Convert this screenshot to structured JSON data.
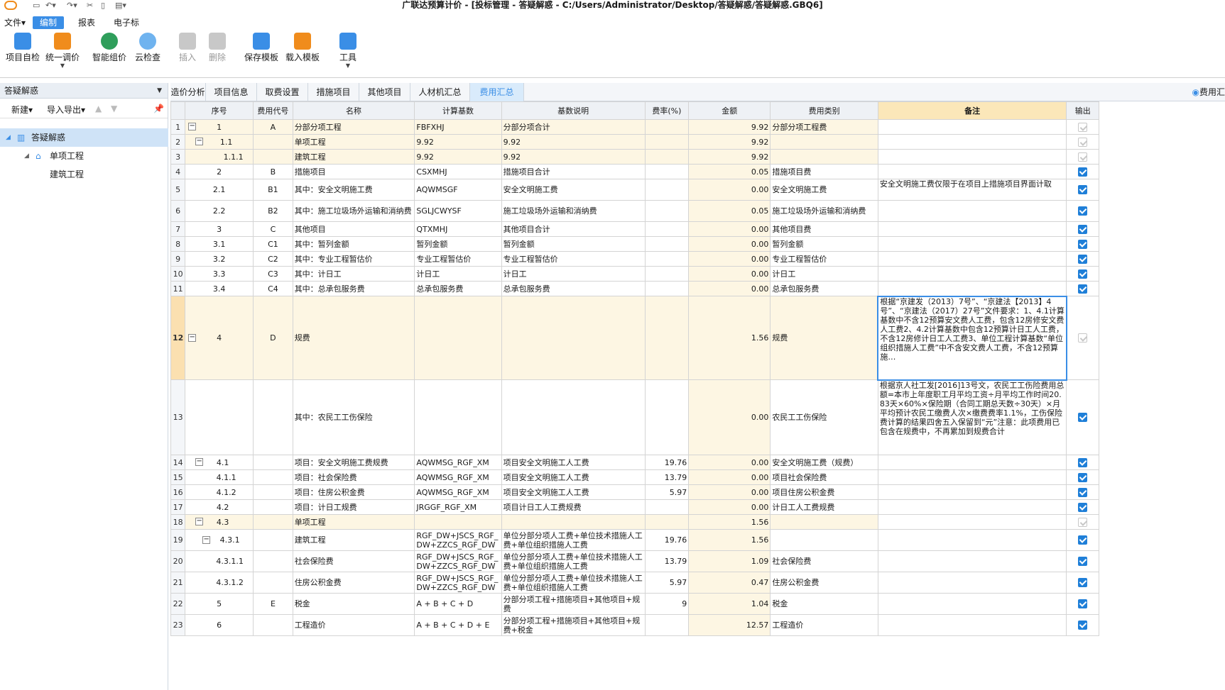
{
  "window": {
    "title": "广联达预算计价 - [投标管理 - 答疑解惑 - C:/Users/Administrator/Desktop/答疑解惑/答疑解惑.GBQ6]"
  },
  "menu": {
    "file": "文件▾",
    "edit": "编制",
    "report": "报表",
    "etender": "电子标"
  },
  "ribbon": {
    "self_check": "项目自检",
    "unify_price": "统一调价",
    "smart_price": "智能组价",
    "cloud_check": "云检查",
    "insert": "插入",
    "delete": "删除",
    "save_tpl": "保存模板",
    "load_tpl": "载入模板",
    "tools": "工具"
  },
  "left": {
    "header": "答疑解惑",
    "new": "新建▾",
    "import_export": "导入导出▾",
    "tree": {
      "root": "答疑解惑",
      "unit": "单项工程",
      "sub": "建筑工程"
    }
  },
  "tabs": [
    "造价分析",
    "项目信息",
    "取费设置",
    "措施项目",
    "其他项目",
    "人材机汇总",
    "费用汇总"
  ],
  "right_label": "费用汇",
  "columns": [
    "序号",
    "费用代号",
    "名称",
    "计算基数",
    "基数说明",
    "费率(%)",
    "金额",
    "费用类别",
    "备注",
    "输出"
  ],
  "rows": [
    {
      "n": "1",
      "seq": "1",
      "code": "A",
      "name": "分部分项工程",
      "base": "FBFXHJ",
      "desc": "分部分项合计",
      "rate": "",
      "amt": "9.92",
      "cat": "分部分项工程费",
      "note": ""
    },
    {
      "n": "2",
      "seq": "1.1",
      "code": "",
      "name": "单项工程",
      "base": "9.92",
      "desc": "9.92",
      "rate": "",
      "amt": "9.92",
      "cat": "",
      "note": ""
    },
    {
      "n": "3",
      "seq": "1.1.1",
      "code": "",
      "name": "建筑工程",
      "base": "9.92",
      "desc": "9.92",
      "rate": "",
      "amt": "9.92",
      "cat": "",
      "note": ""
    },
    {
      "n": "4",
      "seq": "2",
      "code": "B",
      "name": "措施项目",
      "base": "CSXMHJ",
      "desc": "措施项目合计",
      "rate": "",
      "amt": "0.05",
      "cat": "措施项目费",
      "note": ""
    },
    {
      "n": "5",
      "seq": "2.1",
      "code": "B1",
      "name": "其中：安全文明施工费",
      "base": "AQWMSGF",
      "desc": "安全文明施工费",
      "rate": "",
      "amt": "0.00",
      "cat": "安全文明施工费",
      "note": "安全文明施工费仅限于在项目上措施项目界面计取"
    },
    {
      "n": "6",
      "seq": "2.2",
      "code": "B2",
      "name": "其中：施工垃圾场外运输和消纳费",
      "base": "SGLJCWYSF",
      "desc": "施工垃圾场外运输和消纳费",
      "rate": "",
      "amt": "0.05",
      "cat": "施工垃圾场外运输和消纳费",
      "note": ""
    },
    {
      "n": "7",
      "seq": "3",
      "code": "C",
      "name": "其他项目",
      "base": "QTXMHJ",
      "desc": "其他项目合计",
      "rate": "",
      "amt": "0.00",
      "cat": "其他项目费",
      "note": ""
    },
    {
      "n": "8",
      "seq": "3.1",
      "code": "C1",
      "name": "其中：暂列金额",
      "base": "暂列金额",
      "desc": "暂列金额",
      "rate": "",
      "amt": "0.00",
      "cat": "暂列金额",
      "note": ""
    },
    {
      "n": "9",
      "seq": "3.2",
      "code": "C2",
      "name": "其中：专业工程暂估价",
      "base": "专业工程暂估价",
      "desc": "专业工程暂估价",
      "rate": "",
      "amt": "0.00",
      "cat": "专业工程暂估价",
      "note": ""
    },
    {
      "n": "10",
      "seq": "3.3",
      "code": "C3",
      "name": "其中：计日工",
      "base": "计日工",
      "desc": "计日工",
      "rate": "",
      "amt": "0.00",
      "cat": "计日工",
      "note": ""
    },
    {
      "n": "11",
      "seq": "3.4",
      "code": "C4",
      "name": "其中：总承包服务费",
      "base": "总承包服务费",
      "desc": "总承包服务费",
      "rate": "",
      "amt": "0.00",
      "cat": "总承包服务费",
      "note": ""
    },
    {
      "n": "12",
      "seq": "4",
      "code": "D",
      "name": "规费",
      "base": "",
      "desc": "",
      "rate": "",
      "amt": "1.56",
      "cat": "规费",
      "note": "根据“京建发（2013）7号”、“京建法【2013】4号”、“京建法（2017）27号”文件要求：1、4.1计算基数中不含12预算安文费人工费，包含12房修安文费人工费2、4.2计算基数中包含12预算计日工人工费，不含12房修计日工人工费3、单位工程计算基数“单位组织措施人工费”中不含安文费人工费，不含12预算施…"
    },
    {
      "n": "13",
      "seq": "",
      "code": "",
      "name": "其中：农民工工伤保险",
      "base": "",
      "desc": "",
      "rate": "",
      "amt": "0.00",
      "cat": "农民工工伤保险",
      "note": "根据京人社工发[2016]13号文，农民工工伤险费用总额=本市上年度职工月平均工资÷月平均工作时间20.83天×60%×保险期（合同工期总天数÷30天）×月平均预计农民工缴费人次×缴费费率1.1%，工伤保险费计算的结果四舍五入保留到“元”注意：此项费用已包含在规费中，不再累加到规费合计"
    },
    {
      "n": "14",
      "seq": "4.1",
      "code": "",
      "name": "项目：安全文明施工费规费",
      "base": "AQWMSG_RGF_XM",
      "desc": "项目安全文明施工人工费",
      "rate": "19.76",
      "amt": "0.00",
      "cat": "安全文明施工费（规费）",
      "note": ""
    },
    {
      "n": "15",
      "seq": "4.1.1",
      "code": "",
      "name": "项目：社会保险费",
      "base": "AQWMSG_RGF_XM",
      "desc": "项目安全文明施工人工费",
      "rate": "13.79",
      "amt": "0.00",
      "cat": "项目社会保险费",
      "note": ""
    },
    {
      "n": "16",
      "seq": "4.1.2",
      "code": "",
      "name": "项目：住房公积金费",
      "base": "AQWMSG_RGF_XM",
      "desc": "项目安全文明施工人工费",
      "rate": "5.97",
      "amt": "0.00",
      "cat": "项目住房公积金费",
      "note": ""
    },
    {
      "n": "17",
      "seq": "4.2",
      "code": "",
      "name": "项目：计日工规费",
      "base": "JRGGF_RGF_XM",
      "desc": "项目计日工人工费规费",
      "rate": "",
      "amt": "0.00",
      "cat": "计日工人工费规费",
      "note": ""
    },
    {
      "n": "18",
      "seq": "4.3",
      "code": "",
      "name": "单项工程",
      "base": "",
      "desc": "",
      "rate": "",
      "amt": "1.56",
      "cat": "",
      "note": ""
    },
    {
      "n": "19",
      "seq": "4.3.1",
      "code": "",
      "name": "建筑工程",
      "base": "RGF_DW+JSCS_RGF_DW+ZZCS_RGF_DW",
      "desc": "单位分部分项人工费+单位技术措施人工费+单位组织措施人工费",
      "rate": "19.76",
      "amt": "1.56",
      "cat": "",
      "note": ""
    },
    {
      "n": "20",
      "seq": "4.3.1.1",
      "code": "",
      "name": "社会保险费",
      "base": "RGF_DW+JSCS_RGF_DW+ZZCS_RGF_DW",
      "desc": "单位分部分项人工费+单位技术措施人工费+单位组织措施人工费",
      "rate": "13.79",
      "amt": "1.09",
      "cat": "社会保险费",
      "note": ""
    },
    {
      "n": "21",
      "seq": "4.3.1.2",
      "code": "",
      "name": "住房公积金费",
      "base": "RGF_DW+JSCS_RGF_DW+ZZCS_RGF_DW",
      "desc": "单位分部分项人工费+单位技术措施人工费+单位组织措施人工费",
      "rate": "5.97",
      "amt": "0.47",
      "cat": "住房公积金费",
      "note": ""
    },
    {
      "n": "22",
      "seq": "5",
      "code": "E",
      "name": "税金",
      "base": "A + B + C + D",
      "desc": "分部分项工程+措施项目+其他项目+规费",
      "rate": "9",
      "amt": "1.04",
      "cat": "税金",
      "note": ""
    },
    {
      "n": "23",
      "seq": "6",
      "code": "",
      "name": "工程造价",
      "base": "A + B + C + D + E",
      "desc": "分部分项工程+措施项目+其他项目+规费+税金",
      "rate": "",
      "amt": "12.57",
      "cat": "工程造价",
      "note": ""
    }
  ],
  "output_checked": [
    false,
    false,
    false,
    true,
    true,
    true,
    true,
    true,
    true,
    true,
    true,
    false,
    true,
    true,
    true,
    true,
    true,
    false,
    true,
    true,
    true,
    true,
    true
  ]
}
